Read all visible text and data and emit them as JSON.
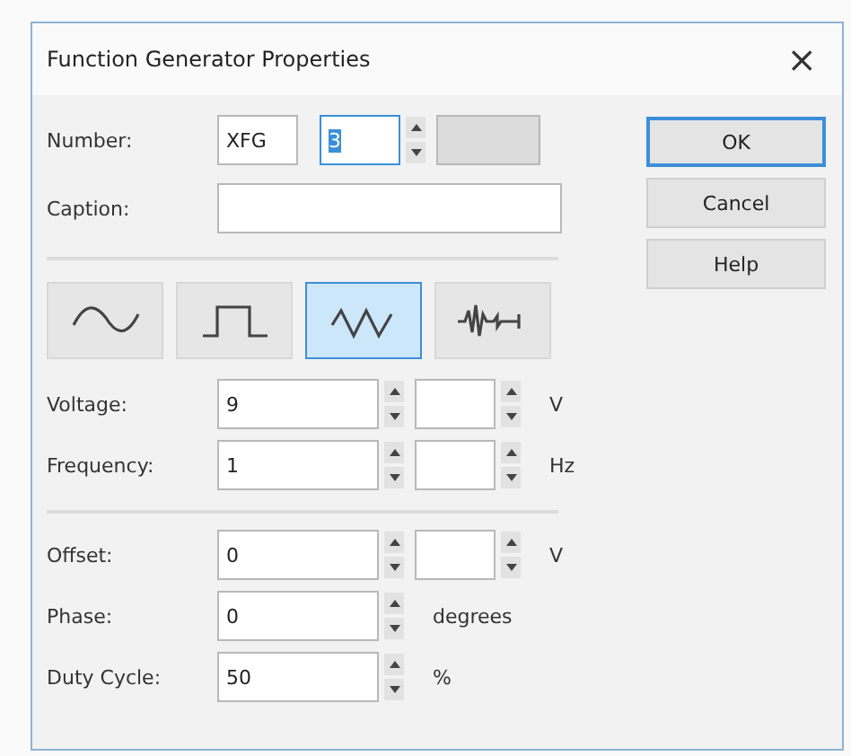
{
  "window": {
    "title": "Function Generator Properties",
    "close": "×"
  },
  "number": {
    "label": "Number:",
    "prefix": "XFG",
    "value": "3",
    "focused": true,
    "dropdown_disabled": true
  },
  "caption": {
    "label": "Caption:"
  },
  "waveforms": [
    {
      "kind": "sine",
      "selected": false
    },
    {
      "kind": "square",
      "selected": false
    },
    {
      "kind": "triangle",
      "selected": true
    },
    {
      "kind": "noise",
      "selected": false
    }
  ],
  "groups": [
    [
      {
        "kind": "dual",
        "label": "Voltage:",
        "value": "9",
        "unit": "V"
      },
      {
        "kind": "dual",
        "label": "Frequency:",
        "value": "1",
        "unit": "Hz"
      }
    ],
    [
      {
        "kind": "dual",
        "label": "Offset:",
        "value": "0",
        "unit": "V"
      },
      {
        "kind": "single",
        "label": "Phase:",
        "value": "0",
        "unit": "degrees"
      },
      {
        "kind": "single",
        "label": "Duty Cycle:",
        "value": "50",
        "unit": "%"
      }
    ]
  ],
  "buttons": [
    {
      "label": "OK",
      "default": true
    },
    {
      "label": "Cancel",
      "default": false
    },
    {
      "label": "Help",
      "default": false
    }
  ]
}
